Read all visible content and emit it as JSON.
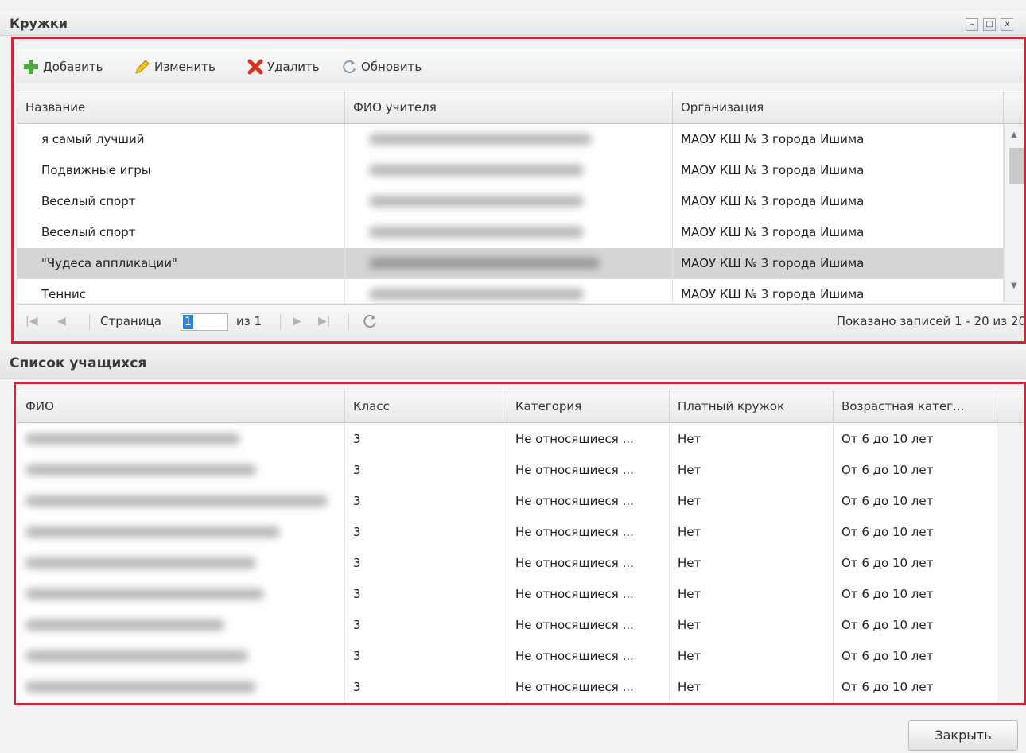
{
  "window": {
    "title": "Кружки",
    "minimize_symbol": "–",
    "maximize_symbol": "□",
    "close_symbol": "x"
  },
  "toolbar": {
    "add_label": "Добавить",
    "edit_label": "Изменить",
    "delete_label": "Удалить",
    "refresh_label": "Обновить"
  },
  "clubs_grid": {
    "columns": [
      "Название",
      "ФИО учителя",
      "Организация"
    ],
    "rows": [
      {
        "name": "я самый лучший",
        "org": "МАОУ КШ № 3 города Ишима",
        "selected": false
      },
      {
        "name": "Подвижные игры",
        "org": "МАОУ КШ № 3 города Ишима",
        "selected": false
      },
      {
        "name": "Веселый спорт",
        "org": "МАОУ КШ № 3 города Ишима",
        "selected": false
      },
      {
        "name": "Веселый спорт",
        "org": "МАОУ КШ № 3 города Ишима",
        "selected": false
      },
      {
        "name": "\"Чудеса аппликации\"",
        "org": "МАОУ КШ № 3 города Ишима",
        "selected": true
      },
      {
        "name": "Теннис",
        "org": "МАОУ КШ № 3 города Ишима",
        "selected": false
      }
    ]
  },
  "pager": {
    "page_label": "Страница",
    "page_value": "1",
    "of_label": "из 1",
    "records_text": "Показано записей 1 - 20 из 20"
  },
  "students": {
    "title": "Список учащихся",
    "columns": [
      "ФИО",
      "Класс",
      "Категория",
      "Платный кружок",
      "Возрастная катег..."
    ],
    "rows": [
      {
        "class": "3",
        "category": "Не относящиеся ...",
        "paid": "Нет",
        "age": "От 6 до 10 лет"
      },
      {
        "class": "3",
        "category": "Не относящиеся ...",
        "paid": "Нет",
        "age": "От 6 до 10 лет"
      },
      {
        "class": "3",
        "category": "Не относящиеся ...",
        "paid": "Нет",
        "age": "От 6 до 10 лет"
      },
      {
        "class": "3",
        "category": "Не относящиеся ...",
        "paid": "Нет",
        "age": "От 6 до 10 лет"
      },
      {
        "class": "3",
        "category": "Не относящиеся ...",
        "paid": "Нет",
        "age": "От 6 до 10 лет"
      },
      {
        "class": "3",
        "category": "Не относящиеся ...",
        "paid": "Нет",
        "age": "От 6 до 10 лет"
      },
      {
        "class": "3",
        "category": "Не относящиеся ...",
        "paid": "Нет",
        "age": "От 6 до 10 лет"
      },
      {
        "class": "3",
        "category": "Не относящиеся ...",
        "paid": "Нет",
        "age": "От 6 до 10 лет"
      },
      {
        "class": "3",
        "category": "Не относящиеся ...",
        "paid": "Нет",
        "age": "От 6 до 10 лет"
      }
    ]
  },
  "footer": {
    "close_label": "Закрыть"
  },
  "colors": {
    "highlight_frame": "#c8283a",
    "selection": "#d5d5d5",
    "page_cursor": "#2f7fd6"
  }
}
